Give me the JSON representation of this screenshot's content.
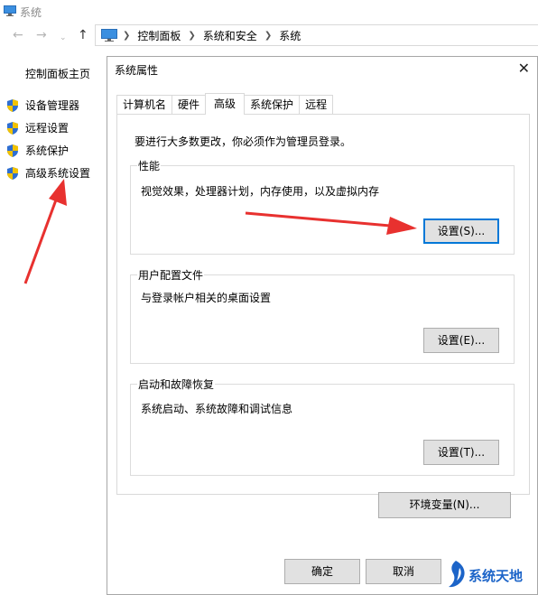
{
  "window": {
    "title": "系统",
    "icon": "monitor-icon"
  },
  "nav": {
    "back_icon": "arrow-left-icon",
    "forward_icon": "arrow-right-icon",
    "recent_icon": "chevron-down-icon",
    "up_icon": "arrow-up-icon",
    "breadcrumb": [
      "控制面板",
      "系统和安全",
      "系统"
    ]
  },
  "left_pane": {
    "home": "控制面板主页",
    "items": [
      {
        "label": "设备管理器",
        "icon": "shield-icon"
      },
      {
        "label": "远程设置",
        "icon": "shield-icon"
      },
      {
        "label": "系统保护",
        "icon": "shield-icon"
      },
      {
        "label": "高级系统设置",
        "icon": "shield-icon"
      }
    ]
  },
  "dialog": {
    "title": "系统属性",
    "close_glyph": "✕",
    "tabs": [
      "计算机名",
      "硬件",
      "高级",
      "系统保护",
      "远程"
    ],
    "active_tab": "高级",
    "admin_note": "要进行大多数更改，你必须作为管理员登录。",
    "performance": {
      "label": "性能",
      "description": "视觉效果，处理器计划，内存使用，以及虚拟内存",
      "button": "设置(S)..."
    },
    "user_profiles": {
      "label": "用户配置文件",
      "description": "与登录帐户相关的桌面设置",
      "button": "设置(E)..."
    },
    "startup_recovery": {
      "label": "启动和故障恢复",
      "description": "系统启动、系统故障和调试信息",
      "button": "设置(T)..."
    },
    "env_button": "环境变量(N)...",
    "ok": "确定",
    "cancel": "取消"
  },
  "watermark": {
    "text": "系统天地"
  },
  "colors": {
    "accent": "#0078d7",
    "arrow": "#e8312f",
    "shield_blue": "#2f6fd1",
    "shield_yellow": "#f2c200"
  }
}
